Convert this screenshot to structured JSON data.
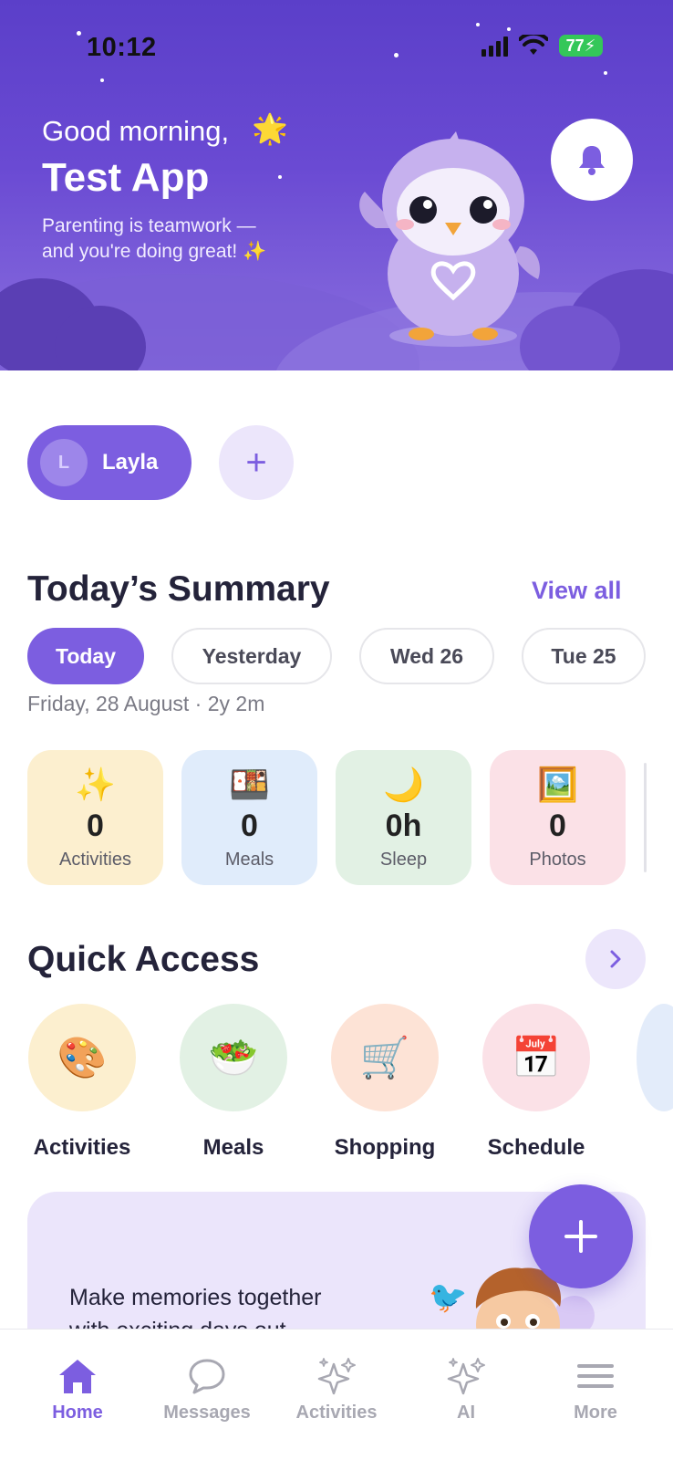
{
  "status_bar": {
    "time": "10:12",
    "battery": "77"
  },
  "hero": {
    "greeting": "Good morning,",
    "greeting_emoji": "🌟",
    "app_name": "Test App",
    "subtitle_line1": "Parenting is teamwork —",
    "subtitle_line2": "and you're doing great!",
    "subtitle_emoji": "✨",
    "notification_icon": "bell-icon"
  },
  "children": {
    "selected": {
      "initial": "L",
      "name": "Layla"
    },
    "add_label": "+"
  },
  "summary": {
    "title": "Today’s Summary",
    "view_all": "View all",
    "days": [
      "Today",
      "Yesterday",
      "Wed 26",
      "Tue 25"
    ],
    "date_line": "Friday, 28 August · 2y 2m",
    "stats": [
      {
        "icon": "✨",
        "value": "0",
        "label": "Activities",
        "color": "#fcefcf"
      },
      {
        "icon": "🍱",
        "value": "0",
        "label": "Meals",
        "color": "#e0ecfb"
      },
      {
        "icon": "🌙",
        "value": "0h",
        "label": "Sleep",
        "color": "#e2f1e4"
      },
      {
        "icon": "🖼️",
        "value": "0",
        "label": "Photos",
        "color": "#fbe1e7"
      }
    ]
  },
  "quick_access": {
    "title": "Quick Access",
    "items": [
      {
        "icon": "🎨",
        "label": "Activities",
        "color": "#fcefcf"
      },
      {
        "icon": "🥗",
        "label": "Meals",
        "color": "#e2f1e4"
      },
      {
        "icon": "🛒",
        "label": "Shopping",
        "color": "#fde3d6"
      },
      {
        "icon": "📅",
        "label": "Schedule",
        "color": "#fbe1e7"
      }
    ]
  },
  "promo": {
    "text_line1": "Make memories together",
    "text_line2": "with exciting days out",
    "bird": "🐦"
  },
  "tabbar": {
    "tabs": [
      {
        "label": "Home",
        "icon": "home-icon"
      },
      {
        "label": "Messages",
        "icon": "chat-icon"
      },
      {
        "label": "Activities",
        "icon": "sparkles-icon"
      },
      {
        "label": "AI",
        "icon": "sparkles-icon"
      },
      {
        "label": "More",
        "icon": "menu-icon"
      }
    ]
  },
  "colors": {
    "accent": "#7c5ee0",
    "hero": "#6a4ad3"
  }
}
